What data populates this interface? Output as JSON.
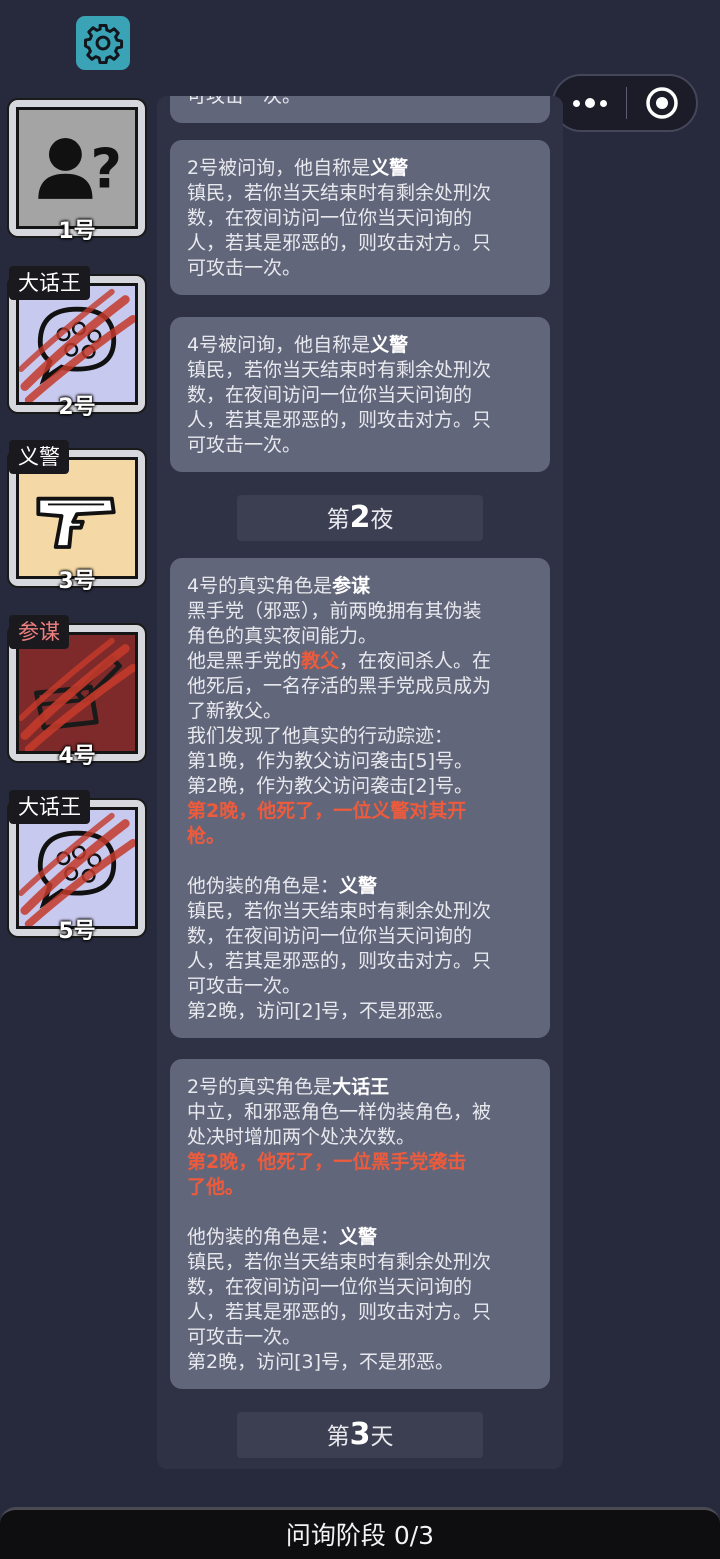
{
  "topbar": {
    "settings_icon": "gear-icon",
    "more_icon": "more-dots-icon",
    "close_icon": "target-circle-icon"
  },
  "players": [
    {
      "number": "1号",
      "role": "",
      "icon": "unknown-person-icon"
    },
    {
      "number": "2号",
      "role": "大话王",
      "icon": "speech-bubble-swirl-icon",
      "dead": true
    },
    {
      "number": "3号",
      "role": "义警",
      "icon": "pistol-icon"
    },
    {
      "number": "4号",
      "role": "参谋",
      "icon": "briefcase-pen-icon",
      "dead": true
    },
    {
      "number": "5号",
      "role": "大话王",
      "icon": "speech-bubble-swirl-icon",
      "dead": true
    }
  ],
  "log": {
    "top_partial": "可攻击一次。",
    "card1": {
      "head_pre": "2号被问询，他自称是",
      "head_role": "义警",
      "lines": [
        "镇民，若你当天结束时有剩余处刑次",
        "数，在夜间访问一位你当天问询的",
        "人，若其是邪恶的，则攻击对方。只",
        "可攻击一次。"
      ]
    },
    "card2": {
      "head_pre": "4号被问询，他自称是",
      "head_role": "义警",
      "lines": [
        "镇民，若你当天结束时有剩余处刑次",
        "数，在夜间访问一位你当天问询的",
        "人，若其是邪恶的，则攻击对方。只",
        "可攻击一次。"
      ]
    },
    "night2": {
      "pre": "第",
      "num": "2",
      "post": "夜"
    },
    "card3": {
      "head_pre": "4号的真实角色是",
      "head_role": "参谋",
      "desc": [
        "黑手党（邪恶），前两晚拥有其伪装",
        "角色的真实夜间能力。"
      ],
      "boss_pre": "他是黑手党的",
      "boss_role": "教父",
      "boss_post": "，在夜间杀人。在",
      "boss_lines": [
        "他死后，一名存活的黑手党成员成为",
        "了新教父。"
      ],
      "trace_lines": [
        "我们发现了他真实的行动踪迹：",
        "第1晚，作为教父访问袭击[5]号。",
        "第2晚，作为教父访问袭击[2]号。"
      ],
      "death_lines": [
        "第2晚，他死了，一位义警对其开",
        "枪。"
      ],
      "disguise_pre": "他伪装的角色是：",
      "disguise_role": "义警",
      "disguise_lines": [
        "镇民，若你当天结束时有剩余处刑次",
        "数，在夜间访问一位你当天问询的",
        "人，若其是邪恶的，则攻击对方。只",
        "可攻击一次。",
        "第2晚，访问[2]号，不是邪恶。"
      ]
    },
    "card4": {
      "head_pre": "2号的真实角色是",
      "head_role": "大话王",
      "desc": [
        "中立，和邪恶角色一样伪装角色，被",
        "处决时增加两个处决次数。"
      ],
      "death_lines": [
        "第2晚，他死了，一位黑手党袭击",
        "了他。"
      ],
      "disguise_pre": "他伪装的角色是：",
      "disguise_role": "义警",
      "disguise_lines": [
        "镇民，若你当天结束时有剩余处刑次",
        "数，在夜间访问一位你当天问询的",
        "人，若其是邪恶的，则攻击对方。只",
        "可攻击一次。",
        "第2晚，访问[3]号，不是邪恶。"
      ]
    },
    "day3": {
      "pre": "第",
      "num": "3",
      "post": "天"
    }
  },
  "bottom": {
    "phase_label": "问询阶段 0/3"
  },
  "colors": {
    "background": "#272a3c",
    "card": "#62667a",
    "accent_red": "#ee5b3c",
    "settings_teal": "#3aa3b5"
  }
}
